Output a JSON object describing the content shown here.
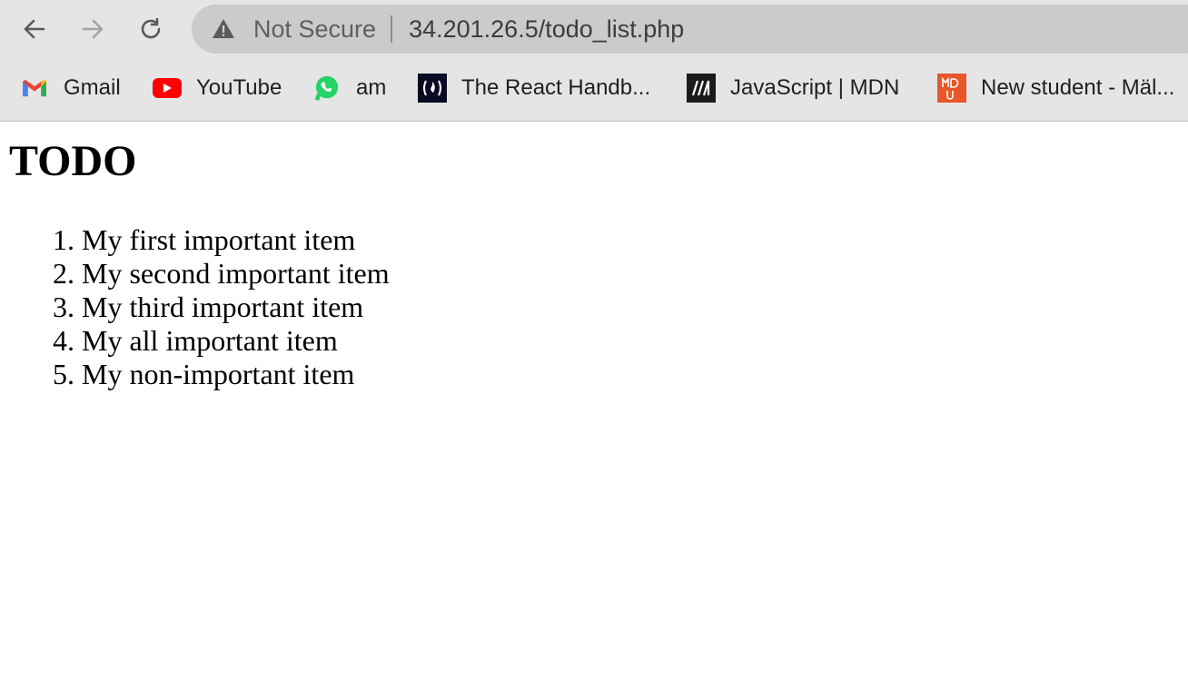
{
  "browser": {
    "back_icon": "arrow-left-icon",
    "forward_icon": "arrow-right-icon",
    "reload_icon": "reload-icon",
    "security_icon": "warning-triangle-icon",
    "security_text": "Not Secure",
    "url": "34.201.26.5/todo_list.php"
  },
  "bookmarks": [
    {
      "label": "Gmail",
      "icon": "gmail-icon"
    },
    {
      "label": "YouTube",
      "icon": "youtube-icon"
    },
    {
      "label": "am",
      "icon": "whatsapp-icon"
    },
    {
      "label": "The React Handb...",
      "icon": "freecodecamp-icon"
    },
    {
      "label": "JavaScript | MDN",
      "icon": "mdn-icon"
    },
    {
      "label": "New student - Mäl...",
      "icon": "mdu-icon"
    }
  ],
  "page": {
    "title": "TODO",
    "items": [
      "My first important item",
      "My second important item",
      "My third important item",
      "My all important item",
      "My non-important item"
    ]
  },
  "colors": {
    "chrome_bg": "#e5e5e5",
    "omnibox_bg": "#cbcbcb",
    "youtube_red": "#ff0000",
    "whatsapp_green": "#25d366",
    "mdu_orange": "#e8562a"
  }
}
